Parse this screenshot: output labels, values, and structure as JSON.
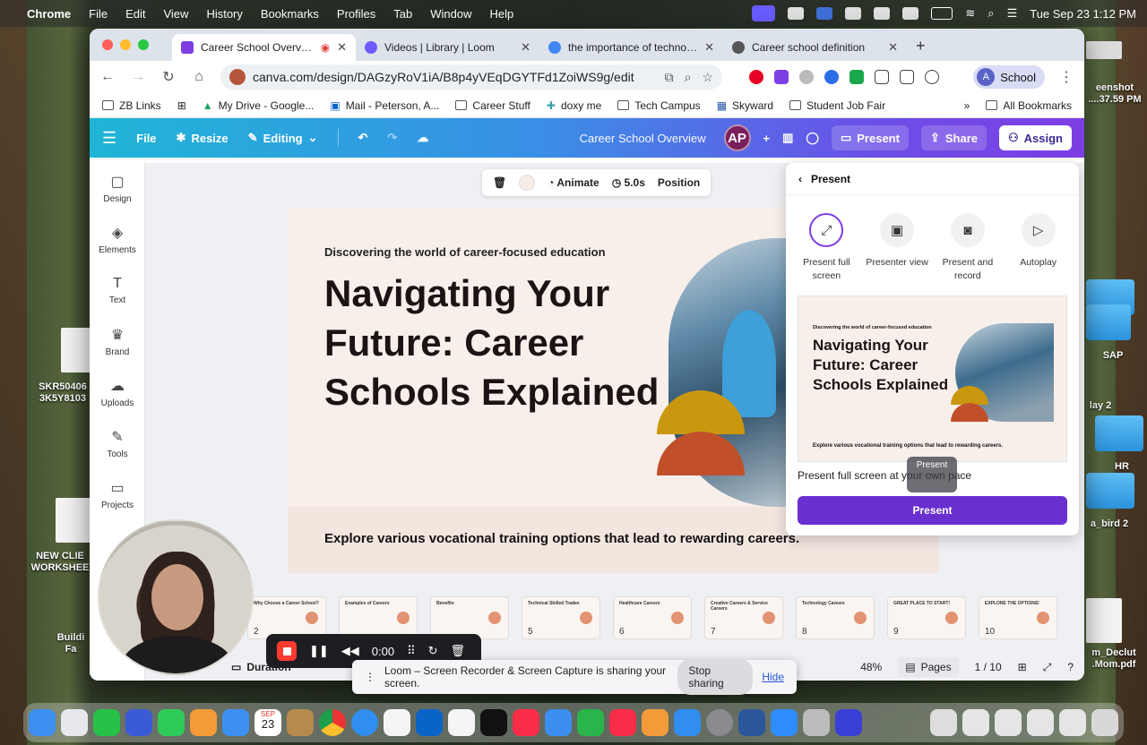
{
  "menubar": {
    "app": "Chrome",
    "items": [
      "File",
      "Edit",
      "View",
      "History",
      "Bookmarks",
      "Profiles",
      "Tab",
      "Window",
      "Help"
    ],
    "clock": "Tue Sep 23  1:12 PM"
  },
  "tabs": [
    {
      "title": "Career School Overview -",
      "active": true,
      "color": "#7d3ee4"
    },
    {
      "title": "Videos | Library | Loom",
      "active": false,
      "color": "#6a5cff"
    },
    {
      "title": "the importance of technology",
      "active": false,
      "color": "#4285f4"
    },
    {
      "title": "Career school definition",
      "active": false,
      "color": "#555555"
    }
  ],
  "address": {
    "url": "canva.com/design/DAGzyRoV1iA/B8p4yVEqDGYTFd1ZoiWS9g/edit"
  },
  "profile": {
    "initial": "A",
    "label": "School"
  },
  "bookmarks": [
    "ZB Links",
    "My Drive - Google...",
    "Mail - Peterson, A...",
    "Career Stuff",
    "doxy me",
    "Tech Campus",
    "Skyward",
    "Student Job Fair"
  ],
  "bookmarks_right": "All Bookmarks",
  "canva_bar": {
    "file": "File",
    "resize": "Resize",
    "editing": "Editing",
    "doc_title": "Career School Overview",
    "avatar": "AP",
    "present": "Present",
    "share": "Share",
    "assign": "Assign"
  },
  "rail": [
    {
      "label": "Design",
      "icon": "▢"
    },
    {
      "label": "Elements",
      "icon": "◈"
    },
    {
      "label": "Text",
      "icon": "T"
    },
    {
      "label": "Brand",
      "icon": "♛"
    },
    {
      "label": "Uploads",
      "icon": "☁"
    },
    {
      "label": "Tools",
      "icon": "✎"
    },
    {
      "label": "Projects",
      "icon": "▭"
    }
  ],
  "context_toolbar": {
    "animate": "Animate",
    "duration": "5.0s",
    "position": "Position"
  },
  "slide": {
    "eyebrow": "Discovering the world of career-focused education",
    "headline": "Navigating Your Future: Career Schools Explained",
    "footer": "Explore various vocational training options that lead to rewarding careers."
  },
  "present_panel": {
    "title": "Present",
    "options": [
      {
        "label": "Present full screen",
        "icon": "⤢",
        "selected": true
      },
      {
        "label": "Presenter view",
        "icon": "▣",
        "selected": false
      },
      {
        "label": "Present and record",
        "icon": "◙",
        "selected": false
      },
      {
        "label": "Autoplay",
        "icon": "▷",
        "selected": false
      }
    ],
    "preview": {
      "eyebrow": "Discovering the world of career-focused education",
      "headline": "Navigating Your Future: Career Schools Explained",
      "footer": "Explore various vocational training options that lead to rewarding careers."
    },
    "description": "Present full screen at your own pace",
    "tooltip": "Present",
    "button": "Present"
  },
  "filmstrip": [
    {
      "n": "2",
      "title": "Why Choose a Career School?"
    },
    {
      "n": "",
      "title": "Examples of Careers"
    },
    {
      "n": "",
      "title": "Benefits"
    },
    {
      "n": "5",
      "title": "Technical Skilled Trades"
    },
    {
      "n": "6",
      "title": "Healthcare Careers"
    },
    {
      "n": "7",
      "title": "Creative Careers & Service Careers"
    },
    {
      "n": "8",
      "title": "Technology Careers"
    },
    {
      "n": "9",
      "title": "GREAT PLACE TO START!"
    },
    {
      "n": "10",
      "title": "EXPLORE THE OPTIONS!"
    }
  ],
  "bottombar": {
    "duration": "Duration",
    "zoom": "48%",
    "pages": "Pages",
    "page_count": "1 / 10"
  },
  "loom": {
    "timer": "0:00",
    "banner": "Loom – Screen Recorder & Screen Capture is sharing your screen.",
    "stop": "Stop sharing",
    "hide": "Hide"
  },
  "desktop": {
    "left_labels": [
      "SKR50406 3K5Y8103",
      "NEW CLIE WORKSHEE",
      "Buildi Fa"
    ],
    "right_labels": [
      "eenshot ....37.59 PM",
      "SAP",
      "lay 2",
      "HR",
      "a_bird 2",
      "m_Declut .Mom.pdf"
    ]
  },
  "dock_date": {
    "month": "SEP",
    "day": "23"
  }
}
